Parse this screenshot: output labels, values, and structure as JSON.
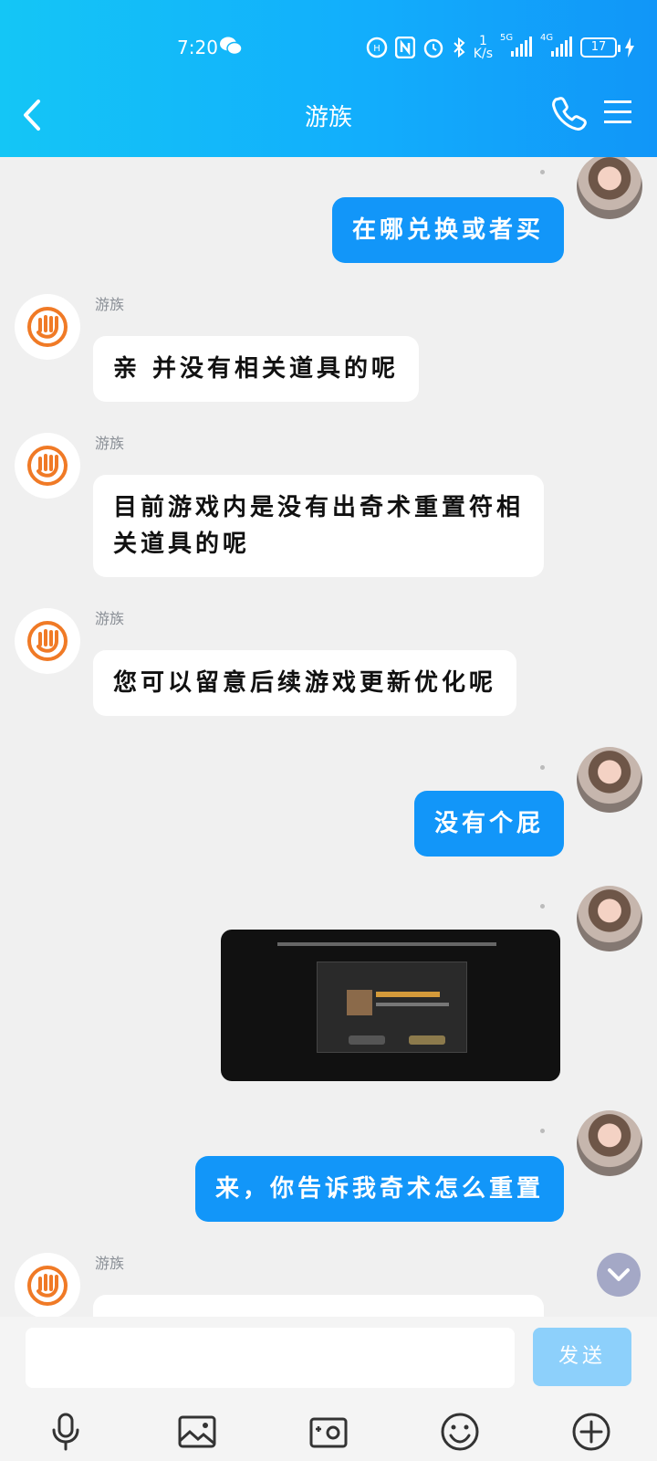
{
  "status_bar": {
    "time": "7:20",
    "net_speed_value": "1",
    "net_speed_unit": "K/s",
    "signal1_label": "5G",
    "signal2_label": "4G",
    "battery": "17"
  },
  "header": {
    "title": "游族"
  },
  "messages": {
    "m1": {
      "text": "在哪兑换或者买"
    },
    "m2": {
      "sender": "游族",
      "text": "亲 并没有相关道具的呢"
    },
    "m3": {
      "sender": "游族",
      "text": "目前游戏内是没有出奇术重置符相关道具的呢"
    },
    "m4": {
      "sender": "游族",
      "text": "您可以留意后续游戏更新优化呢"
    },
    "m5": {
      "text": "没有个屁"
    },
    "m7": {
      "text": "来，你告诉我奇术怎么重置"
    },
    "m8": {
      "sender": "游族"
    }
  },
  "composer": {
    "input_value": "",
    "send_label": "发送"
  },
  "colors": {
    "header_start": "#14c6f6",
    "header_end": "#1196f8",
    "outgoing_bubble": "#1296f9",
    "send_button": "#8dd0fb",
    "bot_avatar_accent": "#f07a26"
  },
  "icons": [
    "back-icon",
    "phone-icon",
    "menu-icon",
    "microphone-icon",
    "image-icon",
    "camera-icon",
    "emoji-icon",
    "plus-icon",
    "chevron-down-icon"
  ]
}
